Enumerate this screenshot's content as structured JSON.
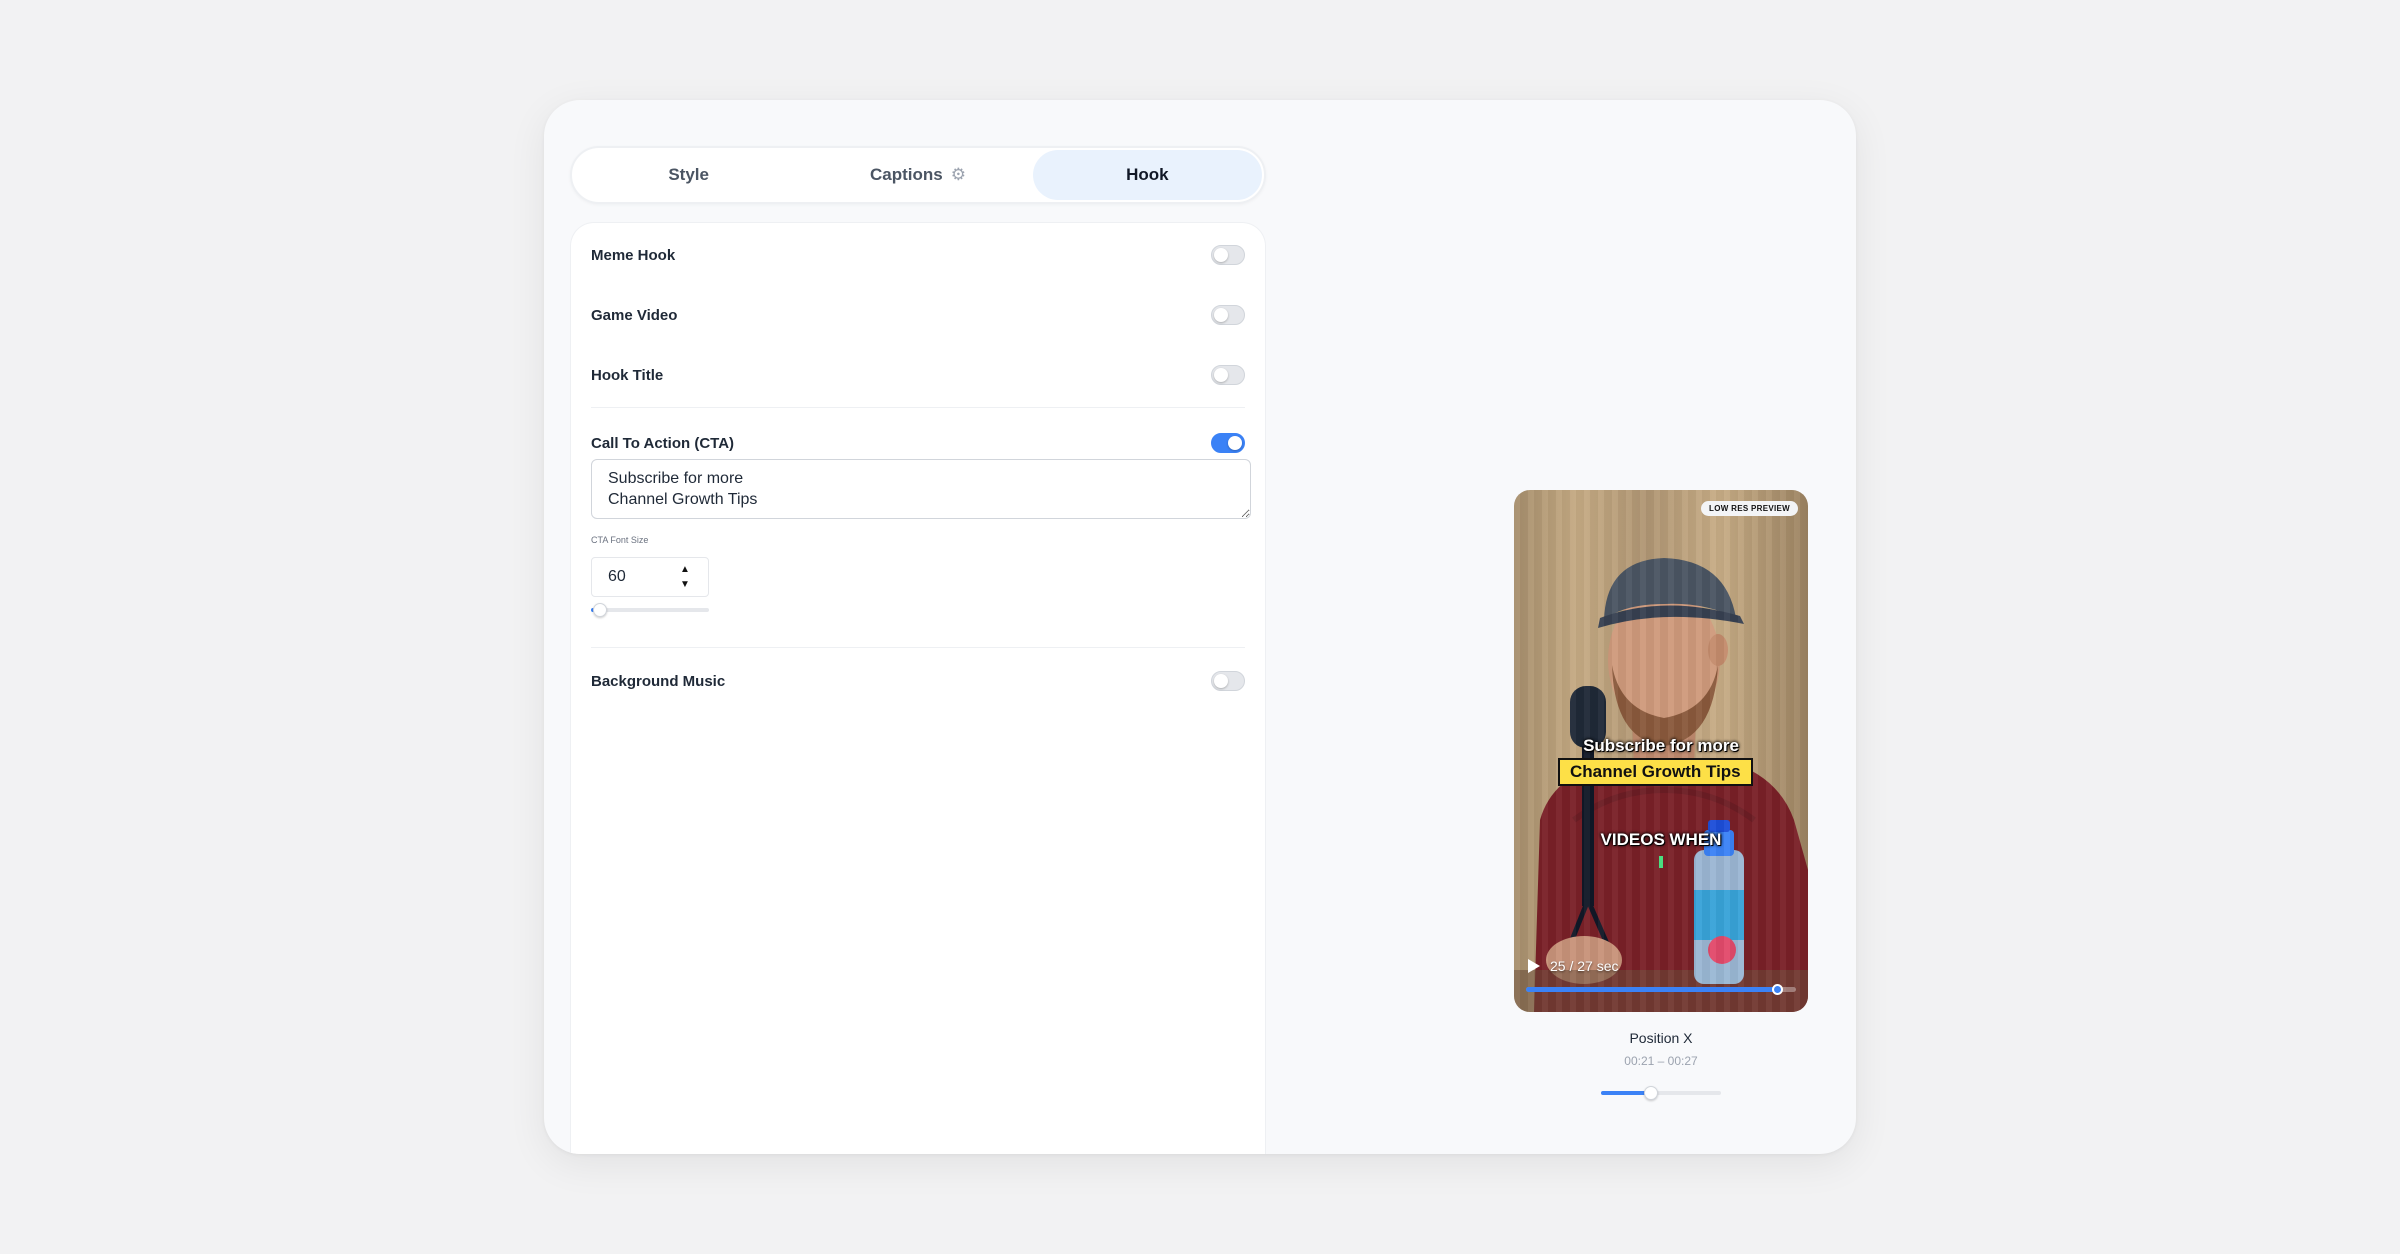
{
  "tabs": [
    {
      "label": "Style",
      "active": false
    },
    {
      "label": "Captions",
      "active": false,
      "icon": "gear-icon"
    },
    {
      "label": "Hook",
      "active": true
    }
  ],
  "settings": {
    "meme_hook": {
      "label": "Meme Hook",
      "enabled": false
    },
    "game_video": {
      "label": "Game Video",
      "enabled": false
    },
    "hook_title": {
      "label": "Hook Title",
      "enabled": false
    },
    "cta": {
      "label": "Call To Action (CTA)",
      "enabled": true,
      "text": "Subscribe for more\nChannel Growth Tips",
      "font_size_label": "CTA Font Size",
      "font_size": "60",
      "font_size_slider_fraction": 0.08
    },
    "background_music": {
      "label": "Background Music",
      "enabled": false
    }
  },
  "preview": {
    "badge": "LOW RES PREVIEW",
    "caption_line_1": "Subscribe for more",
    "caption_line_2": "Channel Growth Tips",
    "caption_line_3": "VIDEOS WHEN",
    "playback_time": "25 / 27 sec",
    "progress_fraction": 0.93,
    "position_label": "Position X",
    "position_range": "00:21 – 00:27",
    "position_slider_fraction": 0.42
  },
  "colors": {
    "accent": "#3b82f6",
    "active_tab_bg": "#e9f2fd",
    "caption_highlight": "#fde047"
  }
}
